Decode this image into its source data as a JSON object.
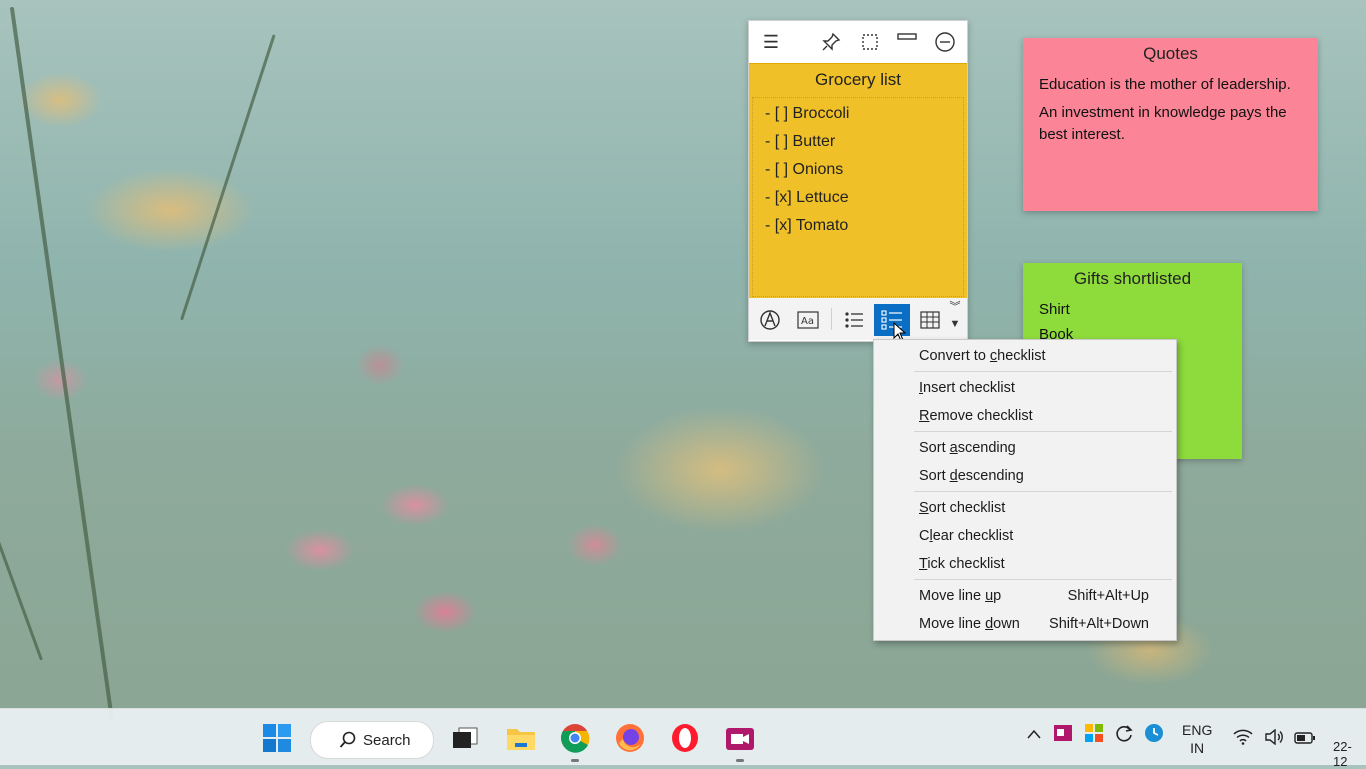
{
  "note_grocery": {
    "title": "Grocery list",
    "items": [
      "- [ ] Broccoli",
      "- [ ] Butter",
      "- [ ] Onions",
      "- [x] Lettuce",
      "- [x] Tomato"
    ]
  },
  "note_quotes": {
    "title": "Quotes",
    "lines": [
      "Education is the mother of leadership.",
      "An investment in knowledge pays the best interest."
    ]
  },
  "note_gifts": {
    "title": "Gifts shortlisted",
    "lines": [
      "Shirt",
      "Book"
    ]
  },
  "context_menu": {
    "items": [
      {
        "pre": "Convert to ",
        "u": "c",
        "post": "hecklist",
        "shortcut": ""
      },
      {
        "pre": "",
        "u": "I",
        "post": "nsert checklist",
        "shortcut": ""
      },
      {
        "pre": "",
        "u": "R",
        "post": "emove checklist",
        "shortcut": ""
      },
      {
        "pre": "Sort ",
        "u": "a",
        "post": "scending",
        "shortcut": ""
      },
      {
        "pre": "Sort ",
        "u": "d",
        "post": "escending",
        "shortcut": ""
      },
      {
        "pre": "",
        "u": "S",
        "post": "ort checklist",
        "shortcut": ""
      },
      {
        "pre": "C",
        "u": "l",
        "post": "ear checklist",
        "shortcut": ""
      },
      {
        "pre": "",
        "u": "T",
        "post": "ick checklist",
        "shortcut": ""
      },
      {
        "pre": "Move line ",
        "u": "u",
        "post": "p",
        "shortcut": "Shift+Alt+Up"
      },
      {
        "pre": "Move line ",
        "u": "d",
        "post": "own",
        "shortcut": "Shift+Alt+Down"
      }
    ]
  },
  "taskbar": {
    "search_label": "Search",
    "lang_top": "ENG",
    "lang_bottom": "IN",
    "date_partial": "22-12"
  },
  "colors": {
    "yellow_note": "#f0c028",
    "pink_note": "#fb8496",
    "green_note": "#8edb3c",
    "active_button": "#0a6fc4"
  }
}
